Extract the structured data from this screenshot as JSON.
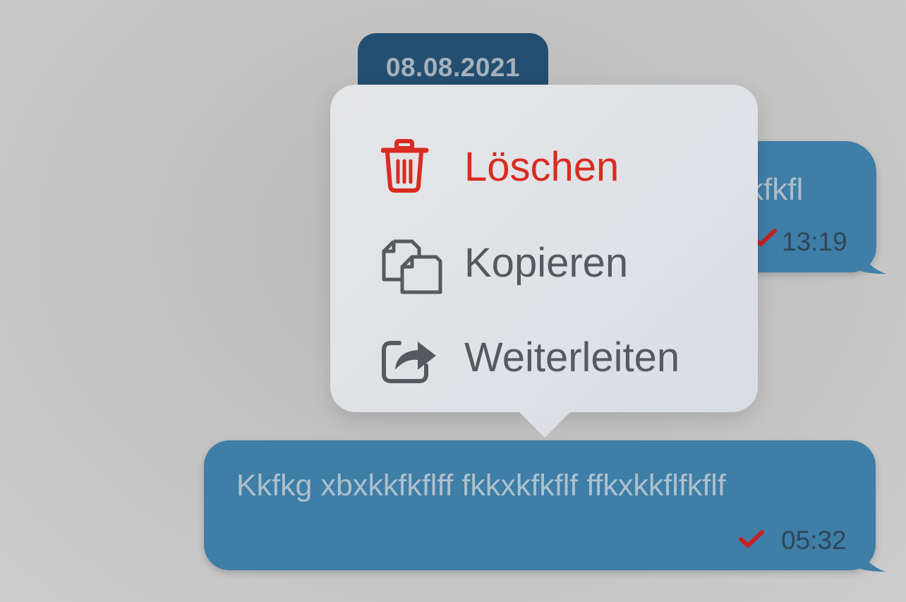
{
  "date_separator": "08.08.2021",
  "messages": [
    {
      "text": "kfkfl",
      "time": "13:19",
      "status_icon": "check-icon",
      "status_color": "#c62020"
    },
    {
      "text": "Kkfkg xbxkkfkflff fkkxkfkflf ffkxkkflfkflf",
      "time": "05:32",
      "status_icon": "check-icon",
      "status_color": "#c62020"
    }
  ],
  "context_menu": {
    "items": [
      {
        "label": "Löschen",
        "icon": "trash-icon",
        "color": "#d92b1f"
      },
      {
        "label": "Kopieren",
        "icon": "copy-icon",
        "color": "#555a5f"
      },
      {
        "label": "Weiterleiten",
        "icon": "forward-icon",
        "color": "#555a5f"
      }
    ]
  },
  "colors": {
    "bubble": "#3e7ea7",
    "date_pill": "#234e70",
    "menu_bg": "#e1e3e6"
  }
}
